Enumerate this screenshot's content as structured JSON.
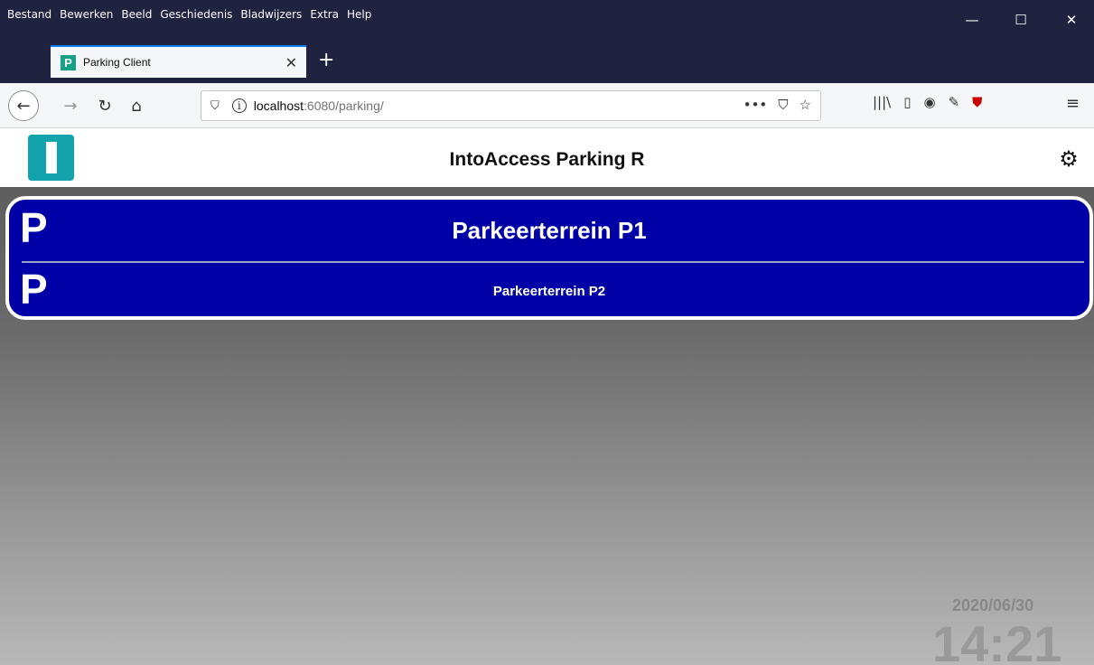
{
  "browser": {
    "menu": [
      "Bestand",
      "Bewerken",
      "Beeld",
      "Geschiedenis",
      "Bladwijzers",
      "Extra",
      "Help"
    ],
    "window_controls": {
      "minimize": "—",
      "maximize": "☐",
      "close": "✕"
    },
    "tab": {
      "title": "Parking Client",
      "favicon": "P",
      "close": "✕"
    },
    "new_tab": "+",
    "nav": {
      "back": "←",
      "forward": "→",
      "reload": "↻",
      "home": "⌂"
    },
    "url": {
      "host": "localhost",
      "rest": ":6080/parking/",
      "shield_icon": "shield-icon",
      "info_icon": "i"
    },
    "url_actions": [
      "•••",
      "⛉",
      "☆"
    ],
    "toolbar_icons": [
      "𝄃𝄃\\",
      "▯",
      "◉",
      "🐄",
      "⛊"
    ],
    "menu_icon": "≡"
  },
  "app": {
    "title": "IntoAccess Parking R",
    "settings_icon": "⚙",
    "parking_lots": [
      {
        "icon": "P",
        "name": "Parkeerterrein P1"
      },
      {
        "icon": "P",
        "name": "Parkeerterrein P2"
      }
    ],
    "date": "2020/06/30",
    "time": "14:21"
  },
  "colors": {
    "browser_dark": "#202340",
    "lot_background": "#0000a7",
    "logo": "#12a3ad"
  }
}
